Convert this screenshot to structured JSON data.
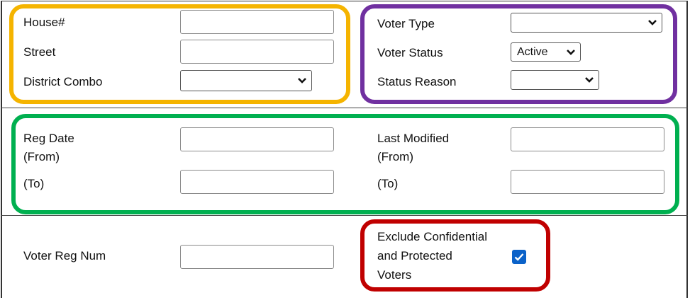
{
  "colors": {
    "address_group": "#f5b400",
    "status_group": "#7030a0",
    "date_group": "#00b050",
    "confidential_group": "#c00000",
    "checkbox_fill": "#0b62c9"
  },
  "address": {
    "house_label": "House#",
    "house_value": "",
    "street_label": "Street",
    "street_value": "",
    "district_label": "District Combo",
    "district_value": ""
  },
  "status": {
    "voter_type_label": "Voter Type",
    "voter_type_value": "",
    "voter_status_label": "Voter Status",
    "voter_status_value": "Active",
    "status_reason_label": "Status Reason",
    "status_reason_value": ""
  },
  "dates": {
    "reg_date_label_1": "Reg Date",
    "reg_date_label_2": "(From)",
    "reg_from_value": "",
    "reg_to_label": "(To)",
    "reg_to_value": "",
    "last_modified_label_1": "Last Modified",
    "last_modified_label_2": "(From)",
    "mod_from_value": "",
    "mod_to_label": "(To)",
    "mod_to_value": ""
  },
  "reg_num": {
    "label": "Voter Reg Num",
    "value": ""
  },
  "confidential": {
    "label_1": "Exclude Confidential",
    "label_2": "and Protected",
    "label_3": "Voters",
    "checked": true
  }
}
